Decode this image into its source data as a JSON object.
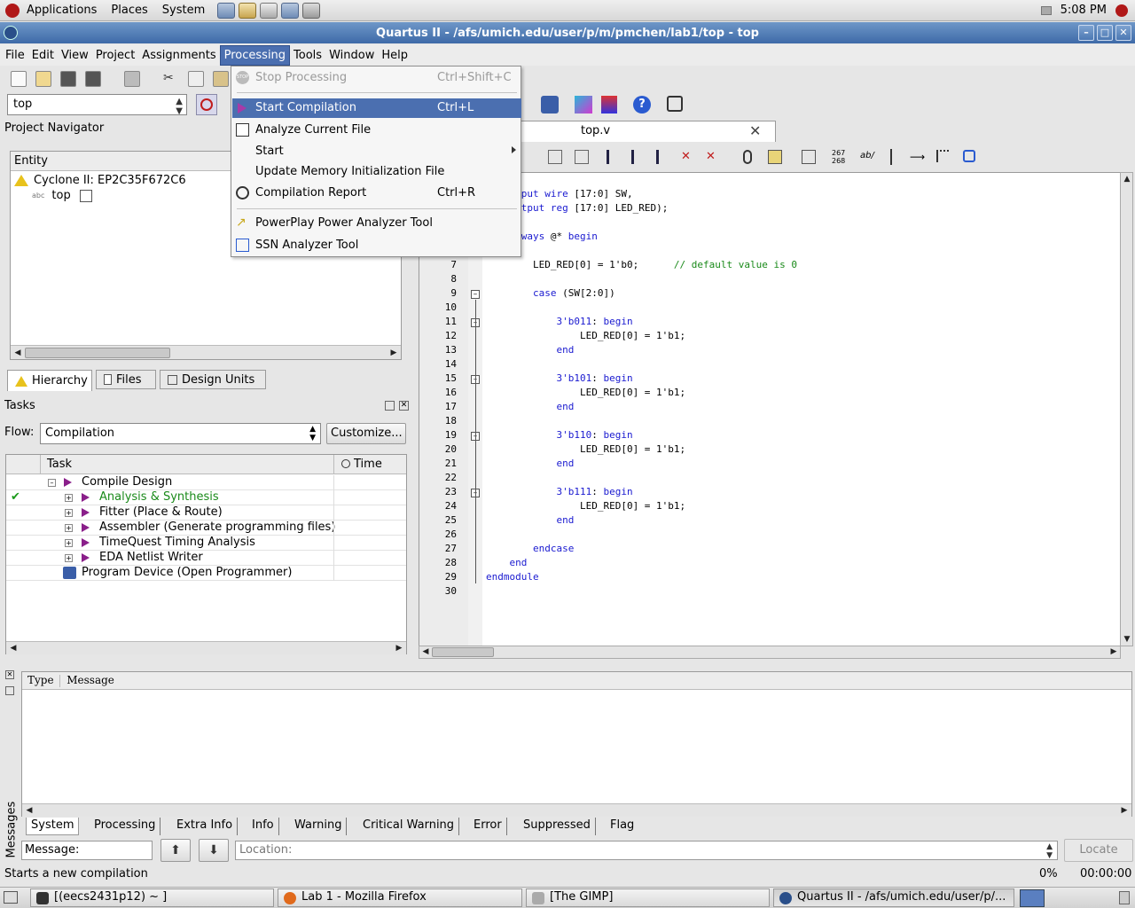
{
  "gnome_panel": {
    "menus": [
      "Applications",
      "Places",
      "System"
    ],
    "clock": "5:08 PM"
  },
  "window": {
    "title": "Quartus II - /afs/umich.edu/user/p/m/pmchen/lab1/top - top"
  },
  "menubar": {
    "items": [
      "File",
      "Edit",
      "View",
      "Project",
      "Assignments",
      "Processing",
      "Tools",
      "Window",
      "Help"
    ],
    "active": "Processing"
  },
  "toolbar": {
    "entity_value": "top"
  },
  "processing_menu": {
    "items": [
      {
        "label": "Stop Processing",
        "shortcut": "Ctrl+Shift+C",
        "icon": "stop-icon",
        "enabled": false
      },
      {
        "label": "Start Compilation",
        "shortcut": "Ctrl+L",
        "icon": "play-icon",
        "selected": true
      },
      {
        "label": "Analyze Current File",
        "shortcut": "",
        "icon": "analyze-icon"
      },
      {
        "label": "Start",
        "shortcut": "",
        "icon": "",
        "submenu": true
      },
      {
        "label": "Update Memory Initialization File",
        "shortcut": "",
        "icon": ""
      },
      {
        "label": "Compilation Report",
        "shortcut": "Ctrl+R",
        "icon": "report-icon"
      },
      {
        "label": "PowerPlay Power Analyzer Tool",
        "shortcut": "",
        "icon": "power-icon"
      },
      {
        "label": "SSN Analyzer Tool",
        "shortcut": "",
        "icon": "ssn-icon"
      }
    ]
  },
  "project_navigator": {
    "title": "Project Navigator",
    "column": "Entity",
    "rows": [
      "Cyclone II: EP2C35F672C6",
      "top"
    ],
    "tabs": [
      "Hierarchy",
      "Files",
      "Design Units"
    ]
  },
  "tasks": {
    "title": "Tasks",
    "flow_label": "Flow:",
    "flow_value": "Compilation",
    "customize": "Customize...",
    "columns": [
      "Task",
      "Time"
    ],
    "rows": [
      {
        "label": "Compile Design",
        "status": ""
      },
      {
        "label": "Analysis & Synthesis",
        "status": "done"
      },
      {
        "label": "Fitter (Place & Route)",
        "status": ""
      },
      {
        "label": "Assembler (Generate programming files)",
        "status": ""
      },
      {
        "label": "TimeQuest Timing Analysis",
        "status": ""
      },
      {
        "label": "EDA Netlist Writer",
        "status": ""
      },
      {
        "label": "Program Device (Open Programmer)",
        "status": ""
      }
    ]
  },
  "editor": {
    "tab": "top.v",
    "lines": [
      {
        "n": "",
        "text": "e top("
      },
      {
        "n": "",
        "text": "    input wire [17:0] SW,"
      },
      {
        "n": "",
        "text": "    output reg [17:0] LED_RED);"
      },
      {
        "n": "",
        "text": ""
      },
      {
        "n": "",
        "text": "    always @* begin"
      },
      {
        "n": "",
        "text": ""
      },
      {
        "n": "7",
        "text": "        LED_RED[0] = 1'b0;      // default value is 0"
      },
      {
        "n": "8",
        "text": ""
      },
      {
        "n": "9",
        "text": "        case (SW[2:0])"
      },
      {
        "n": "10",
        "text": ""
      },
      {
        "n": "11",
        "text": "            3'b011: begin"
      },
      {
        "n": "12",
        "text": "                LED_RED[0] = 1'b1;"
      },
      {
        "n": "13",
        "text": "            end"
      },
      {
        "n": "14",
        "text": ""
      },
      {
        "n": "15",
        "text": "            3'b101: begin"
      },
      {
        "n": "16",
        "text": "                LED_RED[0] = 1'b1;"
      },
      {
        "n": "17",
        "text": "            end"
      },
      {
        "n": "18",
        "text": ""
      },
      {
        "n": "19",
        "text": "            3'b110: begin"
      },
      {
        "n": "20",
        "text": "                LED_RED[0] = 1'b1;"
      },
      {
        "n": "21",
        "text": "            end"
      },
      {
        "n": "22",
        "text": ""
      },
      {
        "n": "23",
        "text": "            3'b111: begin"
      },
      {
        "n": "24",
        "text": "                LED_RED[0] = 1'b1;"
      },
      {
        "n": "25",
        "text": "            end"
      },
      {
        "n": "26",
        "text": ""
      },
      {
        "n": "27",
        "text": "        endcase"
      },
      {
        "n": "28",
        "text": "    end"
      },
      {
        "n": "29",
        "text": "endmodule"
      },
      {
        "n": "30",
        "text": ""
      }
    ]
  },
  "messages": {
    "side_label": "Messages",
    "columns": [
      "Type",
      "Message"
    ],
    "tabs": [
      "System",
      "Processing",
      "Extra Info",
      "Info",
      "Warning",
      "Critical Warning",
      "Error",
      "Suppressed",
      "Flag"
    ],
    "message_label": "Message:",
    "location_placeholder": "Location:",
    "locate": "Locate"
  },
  "status_bar": {
    "text": "Starts a new compilation",
    "percent": "0%",
    "time": "00:00:00"
  },
  "taskbar": {
    "items": [
      {
        "label": "[(eecs2431p12)  ~  ]",
        "icon": "terminal-icon"
      },
      {
        "label": "Lab 1 - Mozilla Firefox",
        "icon": "firefox-icon"
      },
      {
        "label": "[The GIMP]",
        "icon": "gimp-icon"
      },
      {
        "label": "Quartus II - /afs/umich.edu/user/p/...",
        "icon": "quartus-icon"
      }
    ]
  }
}
